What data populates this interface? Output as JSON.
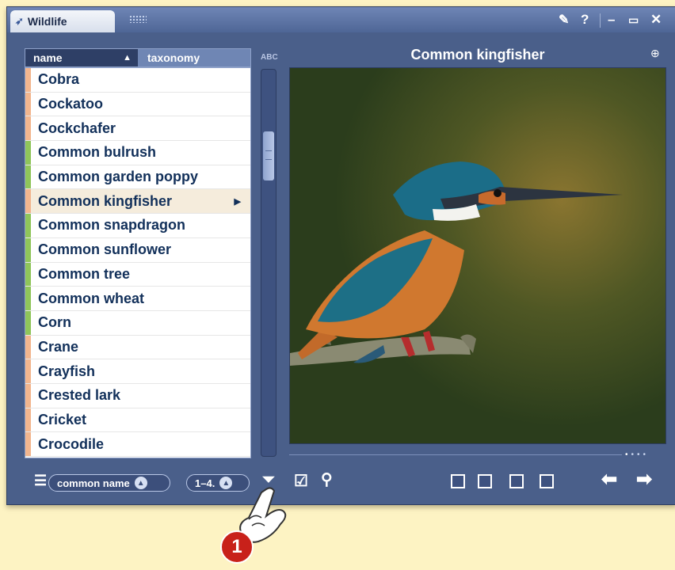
{
  "window": {
    "app_title": "Wildlife",
    "controls": [
      "pin",
      "help",
      "minimize",
      "maximize",
      "close"
    ]
  },
  "list": {
    "header": {
      "name_label": "name",
      "taxonomy_label": "taxonomy",
      "sort_indicator": "▲"
    },
    "scroll_label": "ABC",
    "items": [
      {
        "label": "Cobra",
        "color": "#f2b58e"
      },
      {
        "label": "Cockatoo",
        "color": "#f2b58e"
      },
      {
        "label": "Cockchafer",
        "color": "#f2b58e"
      },
      {
        "label": "Common bulrush",
        "color": "#8fc55a"
      },
      {
        "label": "Common garden poppy",
        "color": "#8fc55a"
      },
      {
        "label": "Common kingfisher",
        "color": "#f2b58e",
        "selected": true
      },
      {
        "label": "Common snapdragon",
        "color": "#8fc55a"
      },
      {
        "label": "Common sunflower",
        "color": "#8fc55a"
      },
      {
        "label": "Common tree",
        "color": "#8fc55a"
      },
      {
        "label": "Common wheat",
        "color": "#8fc55a"
      },
      {
        "label": "Corn",
        "color": "#8fc55a"
      },
      {
        "label": "Crane",
        "color": "#f2b58e"
      },
      {
        "label": "Crayfish",
        "color": "#f2b58e"
      },
      {
        "label": "Crested lark",
        "color": "#f2b58e"
      },
      {
        "label": "Cricket",
        "color": "#f2b58e"
      },
      {
        "label": "Crocodile",
        "color": "#f2b58e"
      }
    ]
  },
  "detail": {
    "title": "Common kingfisher",
    "image_icon": "kingfisher-photo"
  },
  "toolbar": {
    "sort_field": "common name",
    "range": "1–4.",
    "callout_number": "1"
  },
  "colors": {
    "window_bg": "#4a5f8a",
    "page_bg": "#fdf3c3",
    "animal_marker": "#f2b58e",
    "plant_marker": "#8fc55a",
    "callout": "#c8211a"
  }
}
